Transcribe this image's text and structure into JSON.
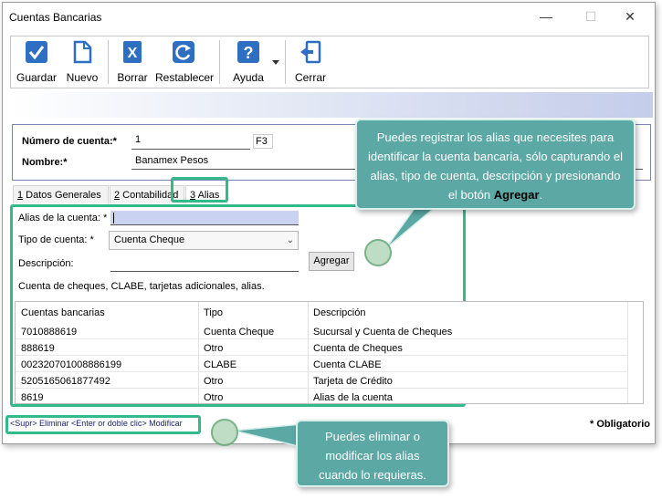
{
  "window": {
    "title": "Cuentas Bancarias"
  },
  "toolbar": {
    "guardar": "Guardar",
    "nuevo": "Nuevo",
    "borrar": "Borrar",
    "restablecer": "Restablecer",
    "ayuda": "Ayuda",
    "cerrar": "Cerrar"
  },
  "form": {
    "numero_label": "Número de cuenta:*",
    "numero_value": "1",
    "numero_shortcut": "F3",
    "nombre_label": "Nombre:*",
    "nombre_value": "Banamex Pesos"
  },
  "tabs": [
    {
      "num": "1",
      "label": " Datos Generales"
    },
    {
      "num": "2",
      "label": " Contabilidad"
    },
    {
      "num": "3",
      "label": " Alias"
    }
  ],
  "alias_panel": {
    "alias_label": "Alias de la cuenta: *",
    "alias_value": "",
    "tipo_label": "Tipo de cuenta: *",
    "tipo_value": "Cuenta Cheque",
    "descripcion_label": "Descripción:",
    "agregar_button": "Agregar",
    "hint": "Cuenta de cheques, CLABE, tarjetas adicionales, alias."
  },
  "grid": {
    "columns": [
      "Cuentas bancarias",
      "Tipo",
      "Descripción"
    ],
    "rows": [
      [
        "7010888619",
        "Cuenta Cheque",
        "Sucursal y Cuenta de Cheques"
      ],
      [
        "888619",
        "Otro",
        "Cuenta de Cheques"
      ],
      [
        "002320701008886199",
        "CLABE",
        "Cuenta CLABE"
      ],
      [
        "5205165061877492",
        "Otro",
        "Tarjeta de Crédito"
      ],
      [
        "8619",
        "Otro",
        "Alias de la cuenta"
      ]
    ]
  },
  "status": {
    "shortcuts": "<Supr> Eliminar   <Enter or doble clic> Modificar",
    "required": "* Obligatorio"
  },
  "callouts": {
    "top_text": "Puedes registrar los alias que necesites para identificar la cuenta bancaria, sólo capturando el alias, tipo de cuenta, descripción y presionando el botón ",
    "top_bold": "Agregar",
    "top_end": ".",
    "bottom_text": "Puedes eliminar o modificar los alias cuando lo requieras."
  },
  "colors": {
    "highlight": "#33b98a",
    "callout": "#5ba8a4",
    "input_active": "#c9d2f0"
  }
}
